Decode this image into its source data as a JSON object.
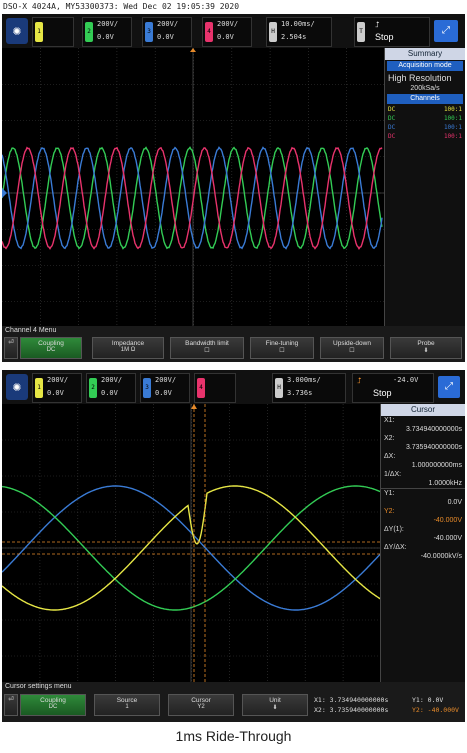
{
  "header": {
    "text": "DSO-X 4024A, MY53300373: Wed Dec 02 19:05:39 2020"
  },
  "scope1": {
    "channels": [
      {
        "label": "1",
        "scale": "",
        "offset": "",
        "color": "#e6e645"
      },
      {
        "label": "2",
        "scale": "200V/",
        "offset": "0.0V",
        "color": "#33cc55"
      },
      {
        "label": "3",
        "scale": "200V/",
        "offset": "0.0V",
        "color": "#3a7bd5"
      },
      {
        "label": "4",
        "scale": "200V/",
        "offset": "0.0V",
        "color": "#e8336c"
      }
    ],
    "timebase": {
      "scale": "10.00ms/",
      "delay": "2.504s"
    },
    "run_state": "Stop",
    "trigger_icon": "trigger-edge-icon",
    "sidebar": {
      "title": "Summary",
      "status": "Acquisition mode",
      "mode": "High Resolution",
      "rate": "200kSa/s",
      "section": "Channels",
      "rows": [
        {
          "coupling": "DC",
          "probe": "100:1",
          "color": "#e6e645"
        },
        {
          "coupling": "DC",
          "probe": "100:1",
          "color": "#33cc55"
        },
        {
          "coupling": "DC",
          "probe": "100:1",
          "color": "#3a7bd5"
        },
        {
          "coupling": "DC",
          "probe": "100:1",
          "color": "#e8336c"
        }
      ]
    },
    "menu_label": "Channel 4 Menu",
    "softkeys": [
      {
        "label": "Coupling",
        "value": "DC"
      },
      {
        "label": "Impedance",
        "value": "1M Ω"
      },
      {
        "label": "Bandwidth limit",
        "value": ""
      },
      {
        "label": "Fine-tuning",
        "value": ""
      },
      {
        "label": "Upside-down",
        "value": ""
      },
      {
        "label": "Probe",
        "value": ""
      }
    ]
  },
  "scope2": {
    "channels": [
      {
        "label": "1",
        "scale": "200V/",
        "offset": "0.0V",
        "color": "#e6e645"
      },
      {
        "label": "2",
        "scale": "200V/",
        "offset": "0.0V",
        "color": "#33cc55"
      },
      {
        "label": "3",
        "scale": "200V/",
        "offset": "0.0V",
        "color": "#3a7bd5"
      },
      {
        "label": "4",
        "scale": "",
        "offset": "",
        "color": "#e8336c"
      }
    ],
    "timebase": {
      "scale": "3.000ms/",
      "delay": "3.736s"
    },
    "trigger_level": "-24.0V",
    "run_state": "Stop",
    "sidebar": {
      "title": "Cursor",
      "x1_label": "X1:",
      "x1": "3.734940000000s",
      "x2_label": "X2:",
      "x2": "3.735940000000s",
      "dx_label": "ΔX:",
      "dx": "1.000000000ms",
      "idx_label": "1/ΔX:",
      "idx": "1.0000kHz",
      "y1_label": "Y1:",
      "y1": "0.0V",
      "y2_label": "Y2:",
      "y2": "-40.000V",
      "dy_label": "ΔY(1):",
      "dy": "-40.000V",
      "dydx_label": "ΔY/ΔX:",
      "dydx": "-40.0000kV/s"
    },
    "menu_label": "Cursor settings menu",
    "softkeys": [
      {
        "label": "Coupling",
        "value": "DC"
      },
      {
        "label": "Source",
        "value": "1"
      },
      {
        "label": "Cursor",
        "value": "Y2"
      },
      {
        "label": "Unit",
        "value": ""
      }
    ],
    "readout": {
      "x1": "X1: 3.734940000000s",
      "x2": "X2: 3.735940000000s",
      "y1": "Y1: 0.0V",
      "y2": "Y2: -40.000V"
    }
  },
  "caption": "1ms Ride-Through"
}
